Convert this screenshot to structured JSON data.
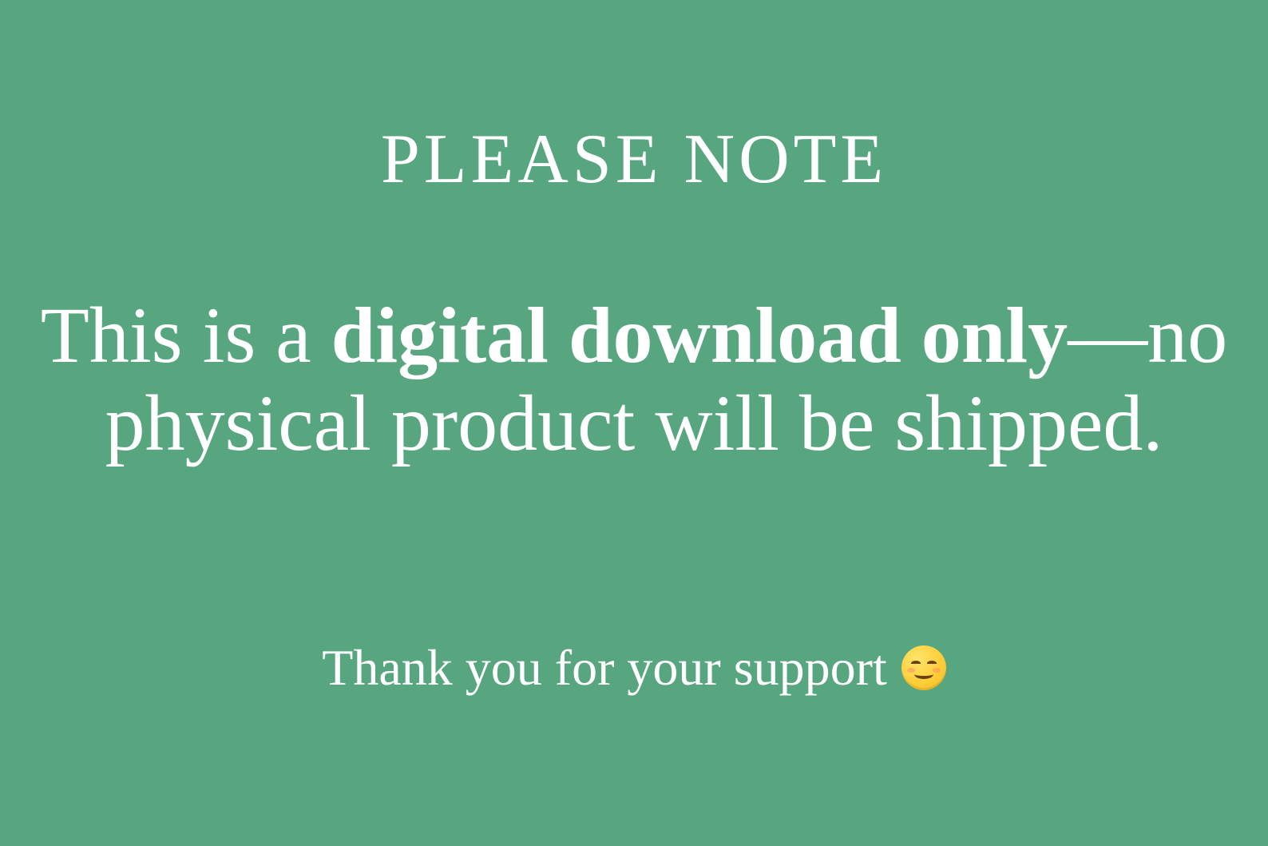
{
  "heading": "PLEASE NOTE",
  "message": {
    "part1": "This is a ",
    "emphasis": "digital download only",
    "part2": "—no physical product will be shipped."
  },
  "thanks": {
    "text": "Thank you for your support",
    "emoji_icon": "smiling-face-emoji-icon"
  },
  "colors": {
    "background": "#58a67f",
    "text": "#ffffff"
  }
}
